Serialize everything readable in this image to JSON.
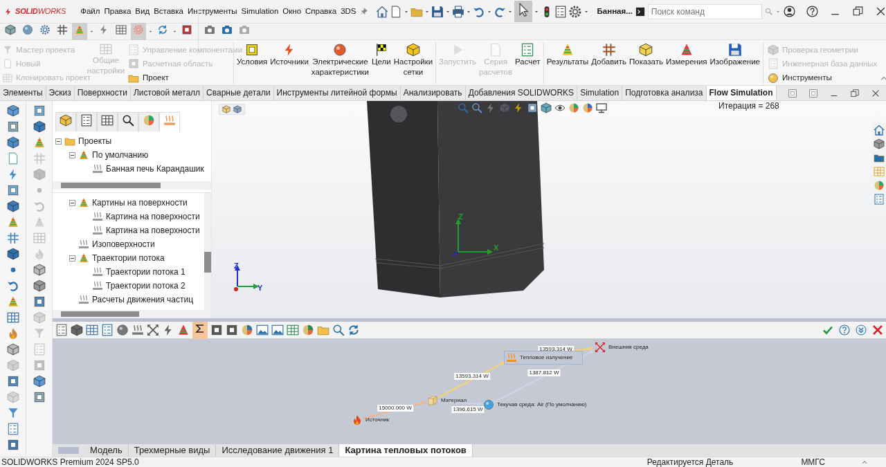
{
  "title_bar": {
    "logo": "**SOLID**WORKS",
    "menu": [
      "Файл",
      "Правка",
      "Вид",
      "Вставка",
      "Инструменты",
      "Simulation",
      "Окно",
      "Справка",
      "3DS"
    ],
    "cursor_tool": {
      "on": true
    },
    "document": "Банная...",
    "search": {
      "placeholder": "Поиск команд"
    }
  },
  "quick_toolbar": [
    {
      "on": false
    },
    {
      "on": false
    },
    {
      "on": false
    },
    {
      "on": false
    },
    {
      "on": true
    },
    {
      "on": false
    },
    {
      "on": false
    },
    {
      "on": true
    },
    {
      "on": false
    },
    {
      "on": false
    },
    {
      "on": false
    },
    {
      "on": false
    },
    {
      "on": false
    }
  ],
  "ribbon": {
    "project_group": {
      "column_1": [
        {
          "label": "Мастер проекта",
          "disabled": true
        },
        {
          "label": "Новый",
          "disabled": true
        },
        {
          "label": "Клонировать проект",
          "disabled": true
        }
      ],
      "general_settings": {
        "label": "Общие настройки",
        "disabled": true
      },
      "column_2": [
        {
          "label": "Управление компонентами",
          "disabled": true
        },
        {
          "label": "Расчетная область",
          "disabled": true
        },
        {
          "label": "Проект",
          "disabled": false
        }
      ]
    },
    "command_groups": [
      {
        "items": [
          {
            "label": "Условия",
            "disabled": false
          },
          {
            "label": "Источники",
            "disabled": false
          },
          {
            "label": "Электрические характеристики",
            "disabled": false
          },
          {
            "label": "Цели",
            "disabled": false
          },
          {
            "label": "Настройки сетки",
            "disabled": false
          }
        ]
      },
      {
        "items": [
          {
            "label": "Запустить",
            "disabled": true
          },
          {
            "label": "Серия расчетов",
            "disabled": true
          },
          {
            "label": "Расчет",
            "disabled": false
          }
        ]
      },
      {
        "items": [
          {
            "label": "Результаты",
            "disabled": false
          },
          {
            "label": "Добавить",
            "disabled": false
          },
          {
            "label": "Показать",
            "disabled": false
          },
          {
            "label": "Измерения",
            "disabled": false
          },
          {
            "label": "Изображение",
            "disabled": false
          }
        ]
      }
    ],
    "tools_group": [
      {
        "label": "Проверка геометрии",
        "disabled": true
      },
      {
        "label": "Инженерная база данных",
        "disabled": true
      },
      {
        "label": "Инструменты",
        "disabled": false
      }
    ]
  },
  "tabs": [
    {
      "label": "Элементы",
      "selected": false
    },
    {
      "label": "Эскиз",
      "selected": false
    },
    {
      "label": "Поверхности",
      "selected": false
    },
    {
      "label": "Листовой металл",
      "selected": false
    },
    {
      "label": "Сварные детали",
      "selected": false
    },
    {
      "label": "Инструменты литейной формы",
      "selected": false
    },
    {
      "label": "Анализировать",
      "selected": false
    },
    {
      "label": "Добавления SOLIDWORKS",
      "selected": false
    },
    {
      "label": "Simulation",
      "selected": false
    },
    {
      "label": "Подготовка анализа",
      "selected": false
    },
    {
      "label": "Flow Simulation",
      "selected": true
    }
  ],
  "left_toolbar": {
    "column_1": [
      {
        "disabled": false
      },
      {
        "disabled": false
      },
      {
        "disabled": false
      },
      {
        "disabled": false
      },
      {
        "disabled": false
      },
      {
        "disabled": false
      },
      {
        "disabled": false
      },
      {
        "disabled": false
      },
      {
        "disabled": false
      },
      {
        "disabled": false
      },
      {
        "disabled": false
      },
      {
        "disabled": false
      },
      {
        "disabled": false
      },
      {
        "disabled": false
      },
      {
        "disabled": false
      },
      {
        "disabled": false
      },
      {
        "disabled": true
      },
      {
        "disabled": false
      },
      {
        "disabled": true
      },
      {
        "disabled": false
      },
      {
        "disabled": false
      },
      {
        "disabled": false
      }
    ],
    "column_2": [
      {
        "disabled": false
      },
      {
        "disabled": false
      },
      {
        "disabled": false
      },
      {
        "disabled": true
      },
      {
        "disabled": true
      },
      {
        "disabled": true
      },
      {
        "disabled": true
      },
      {
        "disabled": true
      },
      {
        "disabled": true
      },
      {
        "disabled": true
      },
      {
        "disabled": false
      },
      {
        "disabled": false
      },
      {
        "disabled": false
      },
      {
        "disabled": true
      },
      {
        "disabled": true
      },
      {
        "disabled": true
      },
      {
        "disabled": true
      },
      {
        "disabled": false
      },
      {
        "disabled": false
      }
    ]
  },
  "feature_manager": {
    "tabs": [
      {
        "selected": false
      },
      {
        "selected": false
      },
      {
        "selected": false
      },
      {
        "selected": false
      },
      {
        "selected": false
      },
      {
        "selected": true
      }
    ],
    "projects_tree": [
      {
        "label": "Проекты",
        "expanded": true,
        "children": [
          {
            "label": "По умолчанию",
            "expanded": true,
            "children": [
              {
                "label": "Банная печь Карандашик"
              }
            ]
          }
        ]
      }
    ],
    "analysis_tree": [
      {
        "label": "Картины на поверхности",
        "expanded": true,
        "children": [
          {
            "label": "Картина на поверхности"
          },
          {
            "label": "Картина на поверхности"
          }
        ]
      },
      {
        "label": "Изоповерхности"
      },
      {
        "label": "Траектории потока",
        "expanded": true,
        "children": [
          {
            "label": "Траектории потока 1"
          },
          {
            "label": "Траектории потока 2"
          }
        ]
      },
      {
        "label": "Расчеты движения частиц"
      }
    ]
  },
  "viewport": {
    "iteration": "Итерация = 268",
    "model_triad": [
      "Z",
      "X"
    ],
    "view_triad": [
      "Z",
      "Y"
    ]
  },
  "heat_flow": {
    "totals_on": true,
    "nodes": [
      {
        "label": "Источник",
        "kind": "source"
      },
      {
        "label": "Материал",
        "kind": "material"
      },
      {
        "label": "Тепловое излучение",
        "kind": "radiation"
      },
      {
        "label": "Внешняя среда",
        "kind": "ambient"
      },
      {
        "label": "Текучая среда: Air (По умолчанию)",
        "kind": "fluid"
      }
    ],
    "flows": [
      {
        "value": "15000.000 W"
      },
      {
        "value": "13593.314 W"
      },
      {
        "value": "1396.615 W"
      },
      {
        "value": "13593.314 W"
      },
      {
        "value": "1387.812 W"
      }
    ]
  },
  "bottom_tabs": [
    {
      "label": "Модель",
      "selected": false
    },
    {
      "label": "Трехмерные виды",
      "selected": false
    },
    {
      "label": "Исследование движения 1",
      "selected": false
    },
    {
      "label": "Картина тепловых потоков",
      "selected": true
    }
  ],
  "status_bar": {
    "product": "SOLIDWORKS Premium 2024 SP5.0",
    "state": "Редактируется Деталь",
    "units": "ММГС"
  }
}
